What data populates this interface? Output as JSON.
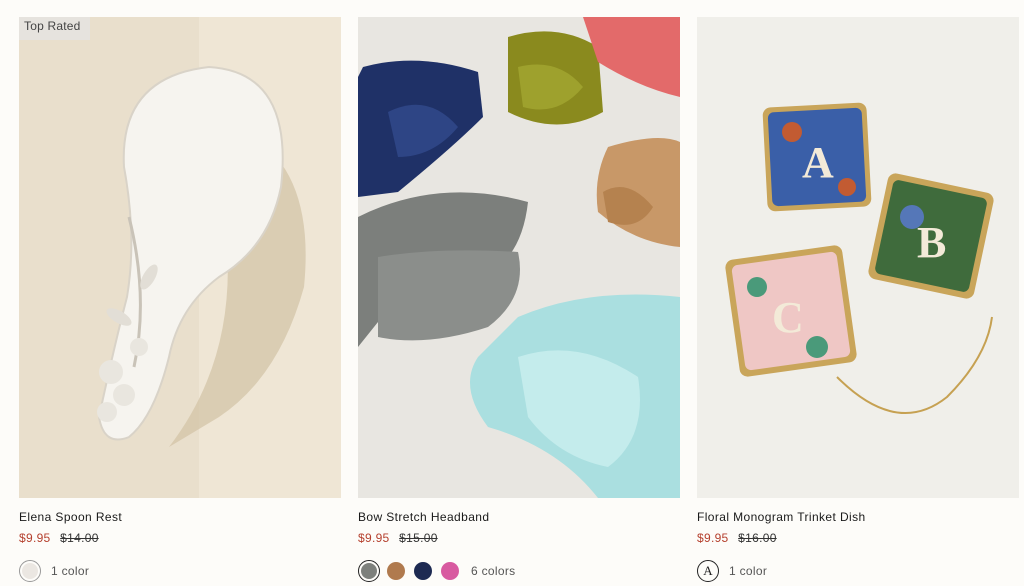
{
  "products": [
    {
      "badge": "Top Rated",
      "name": "Elena Spoon Rest",
      "sale_price": "$9.95",
      "original_price": "$14.00",
      "colors_label": "1 color",
      "swatches": [
        {
          "name": "white",
          "color": "#ebe7e2"
        }
      ]
    },
    {
      "name": "Bow Stretch Headband",
      "sale_price": "$9.95",
      "original_price": "$15.00",
      "colors_label": "6 colors",
      "swatches": [
        {
          "name": "grey",
          "color": "#7d807c"
        },
        {
          "name": "tan",
          "color": "#b07a4e"
        },
        {
          "name": "navy",
          "color": "#1d2a52"
        },
        {
          "name": "pink",
          "color": "#d85aa0"
        }
      ]
    },
    {
      "name": "Floral Monogram Trinket Dish",
      "sale_price": "$9.95",
      "original_price": "$16.00",
      "colors_label": "1 color",
      "swatches": [
        {
          "name": "monogram-A",
          "letter": "A"
        }
      ]
    }
  ],
  "colors": {
    "sale": "#b5402e",
    "badge_bg": "#e6e3de"
  }
}
